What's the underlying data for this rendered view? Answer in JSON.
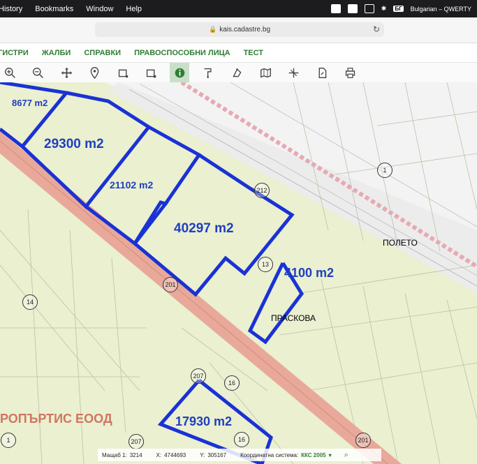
{
  "menubar": {
    "items": [
      "History",
      "Bookmarks",
      "Window",
      "Help"
    ],
    "keyboard_badge": "БГ",
    "keyboard_name": "Bulgarian – QWERTY"
  },
  "browser": {
    "url": "kais.cadastre.bg"
  },
  "nav": {
    "items": [
      "ГИСТРИ",
      "ЖАЛБИ",
      "СПРАВКИ",
      "ПРАВОСПОСОБНИ ЛИЦА",
      "ТЕСТ"
    ],
    "color": "#2e7d32"
  },
  "toolbar": {
    "tools": [
      "zoom-in-icon",
      "zoom-out-icon",
      "pan-icon",
      "location-pin-icon",
      "select-rect-icon",
      "select-rect-alt-icon",
      "info-icon",
      "measure-icon",
      "identify-icon",
      "layers-map-icon",
      "crop-icon",
      "document-icon",
      "print-icon"
    ],
    "active_tool": "info-icon"
  },
  "map": {
    "parcel_areas": [
      {
        "label": "8677 m2"
      },
      {
        "label": "29300 m2"
      },
      {
        "label": "21102 m2"
      },
      {
        "label": "40297 m2"
      },
      {
        "label": "4100 m2"
      },
      {
        "label": "17930 m2"
      }
    ],
    "place_names": [
      "ПОЛЕТО",
      "ПРАСКОВА"
    ],
    "owner_label": "РОПЪРТИС ЕООД",
    "parcel_numbers": [
      "1",
      "13",
      "14",
      "16",
      "16",
      "201",
      "201",
      "207",
      "207",
      "1",
      "212"
    ],
    "outline_color": "#1a32d4",
    "road_color": "#e8a99a"
  },
  "statusbar": {
    "scale_label": "Мащаб 1:",
    "scale_value": "3214",
    "x_label": "X:",
    "x_value": "4744693",
    "y_label": "Y:",
    "y_value": "305167",
    "system_label": "Координатна система:",
    "system_value": "ККС 2005"
  }
}
